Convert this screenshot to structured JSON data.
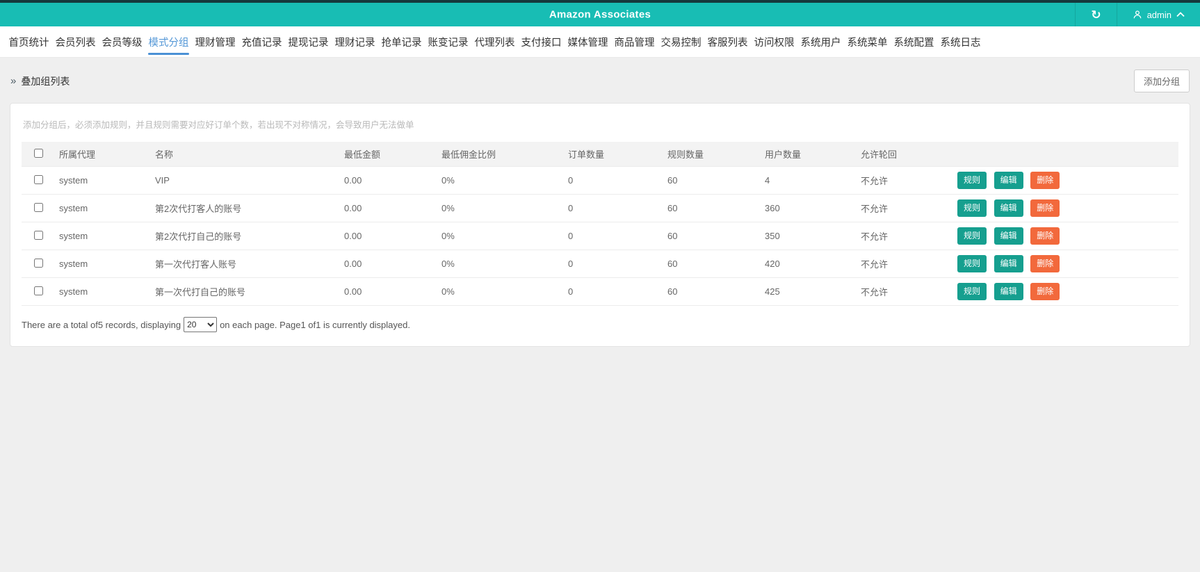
{
  "topbar": {
    "title": "Amazon Associates",
    "username": "admin",
    "refresh_icon": "↻"
  },
  "nav": {
    "tabs": [
      {
        "label": "首页统计",
        "active": false
      },
      {
        "label": "会员列表",
        "active": false
      },
      {
        "label": "会员等级",
        "active": false
      },
      {
        "label": "模式分组",
        "active": true
      },
      {
        "label": "理财管理",
        "active": false
      },
      {
        "label": "充值记录",
        "active": false
      },
      {
        "label": "提现记录",
        "active": false
      },
      {
        "label": "理财记录",
        "active": false
      },
      {
        "label": "抢单记录",
        "active": false
      },
      {
        "label": "账变记录",
        "active": false
      },
      {
        "label": "代理列表",
        "active": false
      },
      {
        "label": "支付接口",
        "active": false
      },
      {
        "label": "媒体管理",
        "active": false
      },
      {
        "label": "商品管理",
        "active": false
      },
      {
        "label": "交易控制",
        "active": false
      },
      {
        "label": "客服列表",
        "active": false
      },
      {
        "label": "访问权限",
        "active": false
      },
      {
        "label": "系统用户",
        "active": false
      },
      {
        "label": "系统菜单",
        "active": false
      },
      {
        "label": "系统配置",
        "active": false
      },
      {
        "label": "系统日志",
        "active": false
      }
    ]
  },
  "breadcrumb": {
    "icon": "»",
    "label": "叠加组列表"
  },
  "toolbar": {
    "add_group": "添加分组"
  },
  "panel": {
    "hint": "添加分组后，必须添加规则，并且规则需要对应好订单个数，若出现不对称情况，会导致用户无法做单",
    "table": {
      "headers": {
        "agent": "所属代理",
        "name": "名称",
        "min_amount": "最低金额",
        "min_commission": "最低佣金比例",
        "order_count": "订单数量",
        "rule_count": "规则数量",
        "user_count": "用户数量",
        "allow_loop": "允许轮回"
      },
      "action_labels": {
        "rule": "规则",
        "edit": "编辑",
        "delete": "删除"
      },
      "rows": [
        {
          "agent": "system",
          "name": "VIP",
          "min_amount": "0.00",
          "min_commission": "0%",
          "order_count": "0",
          "rule_count": "60",
          "user_count": "4",
          "allow_loop": "不允许"
        },
        {
          "agent": "system",
          "name": "第2次代打客人的账号",
          "min_amount": "0.00",
          "min_commission": "0%",
          "order_count": "0",
          "rule_count": "60",
          "user_count": "360",
          "allow_loop": "不允许"
        },
        {
          "agent": "system",
          "name": "第2次代打自己的账号",
          "min_amount": "0.00",
          "min_commission": "0%",
          "order_count": "0",
          "rule_count": "60",
          "user_count": "350",
          "allow_loop": "不允许"
        },
        {
          "agent": "system",
          "name": "第一次代打客人账号",
          "min_amount": "0.00",
          "min_commission": "0%",
          "order_count": "0",
          "rule_count": "60",
          "user_count": "420",
          "allow_loop": "不允许"
        },
        {
          "agent": "system",
          "name": "第一次代打自己的账号",
          "min_amount": "0.00",
          "min_commission": "0%",
          "order_count": "0",
          "rule_count": "60",
          "user_count": "425",
          "allow_loop": "不允许"
        }
      ]
    },
    "pagination": {
      "text_before": "There are a total of5 records, displaying",
      "page_size": "20",
      "text_after": "on each page. Page1 of1 is currently displayed."
    }
  },
  "colors": {
    "header_teal": "#18bdb4",
    "active_tab_blue": "#5598d7",
    "button_teal": "#169f8f",
    "button_orange": "#f2693c",
    "page_background": "#efefef"
  }
}
